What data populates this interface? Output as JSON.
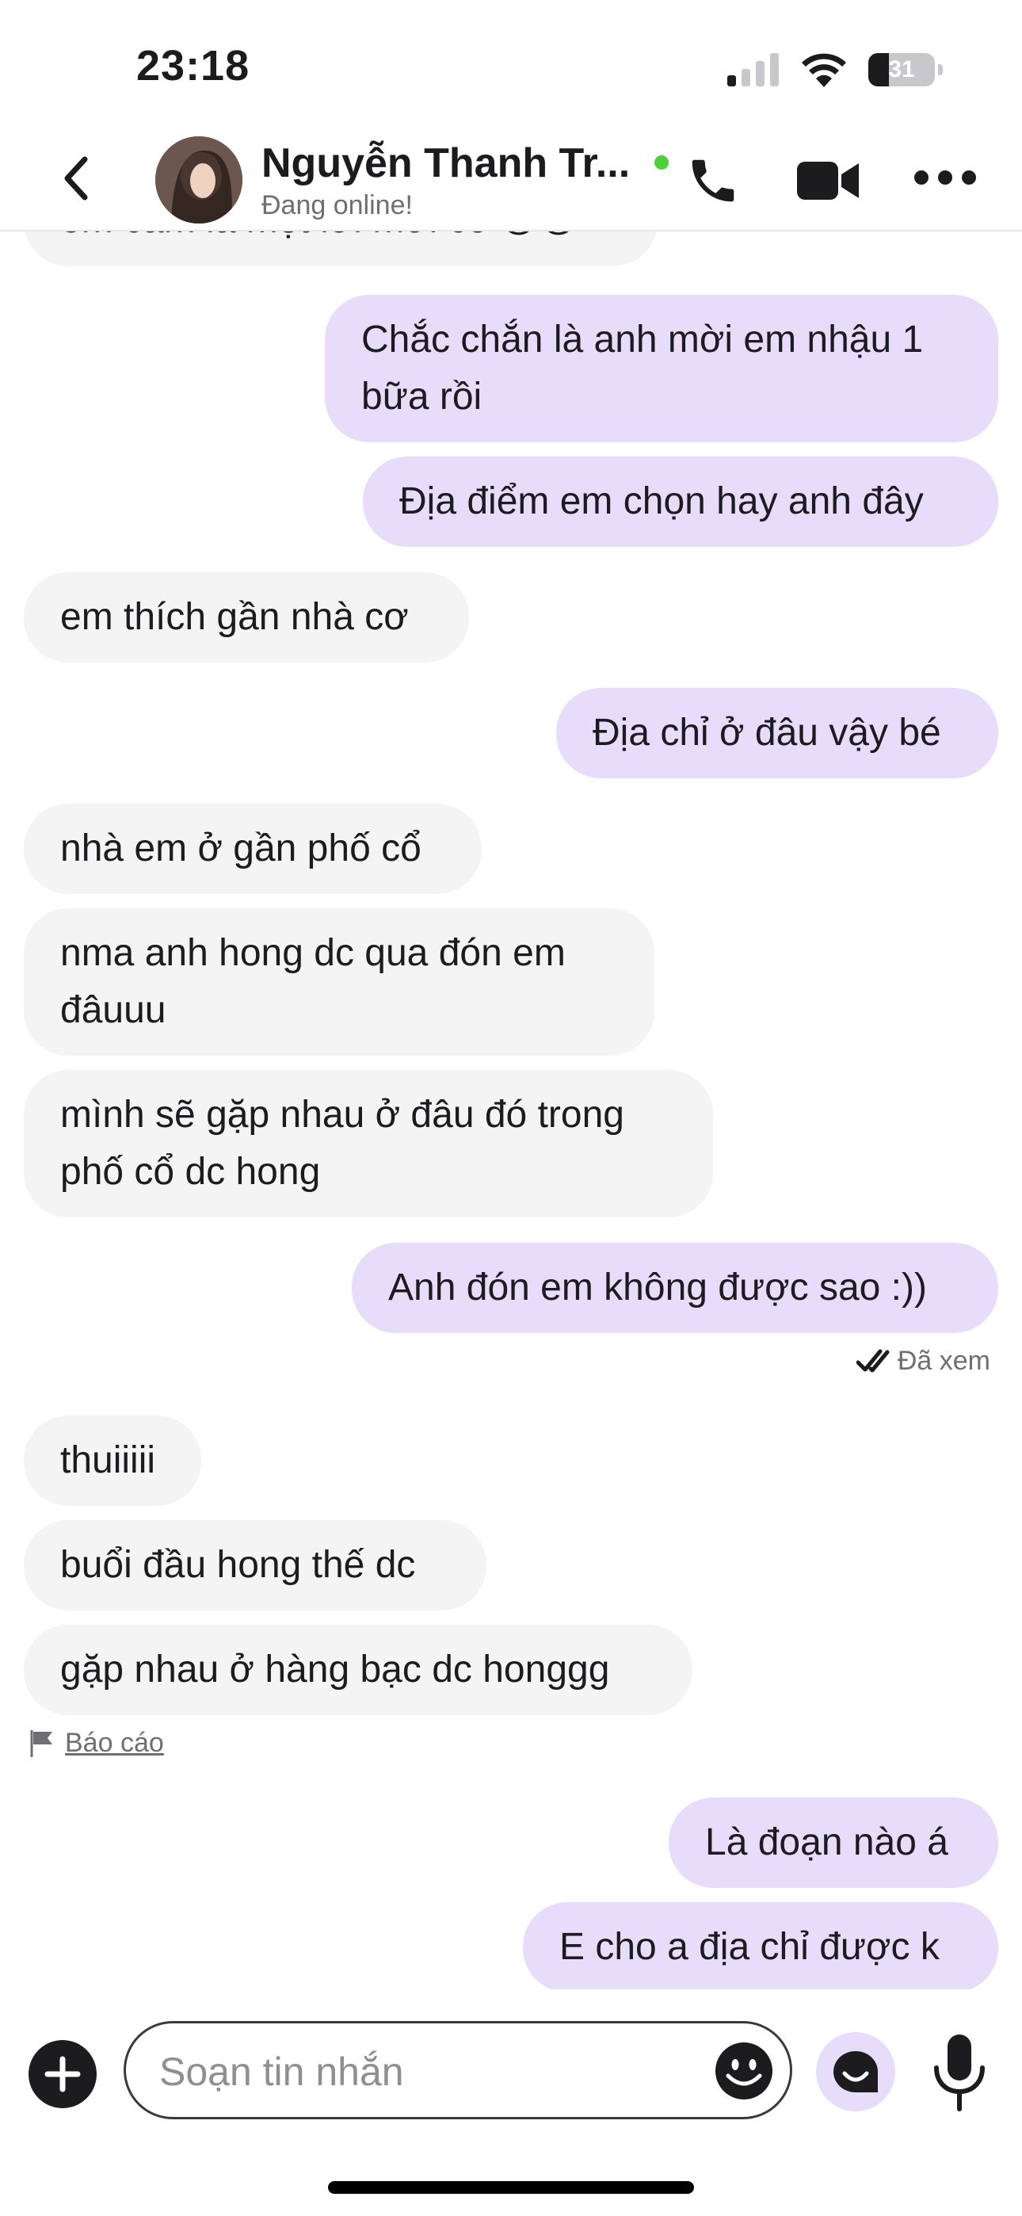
{
  "status_bar": {
    "time": "23:18",
    "battery": "31"
  },
  "header": {
    "contact_name": "Nguyễn Thanh Tr...",
    "status": "Đang online!"
  },
  "messages": [
    {
      "dir": "in",
      "text": "em cảm là một lời mời có 😩😩"
    },
    {
      "dir": "out",
      "text": "Chắc chắn là anh mời em nhậu 1 bữa rồi"
    },
    {
      "dir": "out",
      "text": "Địa điểm em chọn hay anh đây"
    },
    {
      "dir": "in",
      "text": "em thích gần nhà cơ"
    },
    {
      "dir": "out",
      "text": "Địa chỉ ở đâu vậy bé"
    },
    {
      "dir": "in",
      "text": "nhà em ở gần phố cổ"
    },
    {
      "dir": "in",
      "text": "nma anh hong dc qua đón em đâuuu"
    },
    {
      "dir": "in",
      "text": "mình sẽ gặp nhau ở đâu đó trong phố cổ dc hong"
    },
    {
      "dir": "out",
      "text": "Anh đón em không được sao :))"
    },
    {
      "dir": "in",
      "text": "thuiiiii"
    },
    {
      "dir": "in",
      "text": "buổi đầu hong thế dc"
    },
    {
      "dir": "in",
      "text": "gặp nhau ở hàng bạc dc honggg"
    },
    {
      "dir": "out",
      "text": "Là đoạn nào á"
    },
    {
      "dir": "out",
      "text": "E cho a địa chỉ được k"
    }
  ],
  "seen_label": "Đã xem",
  "report_label": "Báo cáo",
  "composer": {
    "placeholder": "Soạn tin nhắn"
  },
  "colors": {
    "incoming": "#f4f4f4",
    "outgoing": "#e8dcfb",
    "online": "#4cd137"
  }
}
